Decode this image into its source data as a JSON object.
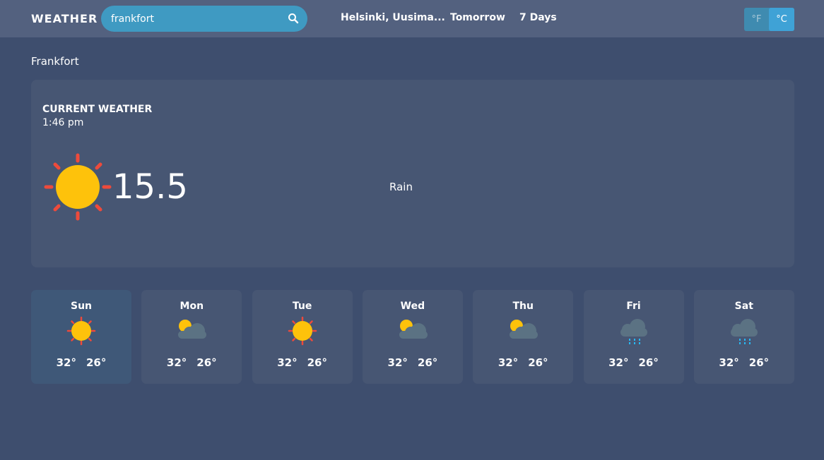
{
  "header": {
    "brand": "WEATHER",
    "search_value": "frankfort",
    "nav": [
      "Helsinki, Uusima...",
      "Tomorrow",
      "7 Days"
    ],
    "unit_f": "°F",
    "unit_c": "°C",
    "active_unit": "°C"
  },
  "city": "Frankfort",
  "current": {
    "title": "CURRENT WEATHER",
    "time": "1:46 pm",
    "icon": "sun-icon",
    "temp": "15.5",
    "description": "Rain"
  },
  "days": [
    {
      "name": "Sun",
      "icon": "sun-icon",
      "high": "32°",
      "low": "26°",
      "active": true
    },
    {
      "name": "Mon",
      "icon": "partly-cloudy-icon",
      "high": "32°",
      "low": "26°"
    },
    {
      "name": "Tue",
      "icon": "sun-icon",
      "high": "32°",
      "low": "26°"
    },
    {
      "name": "Wed",
      "icon": "partly-cloudy-icon",
      "high": "32°",
      "low": "26°"
    },
    {
      "name": "Thu",
      "icon": "partly-cloudy-icon",
      "high": "32°",
      "low": "26°"
    },
    {
      "name": "Fri",
      "icon": "rain-cloud-icon",
      "high": "32°",
      "low": "26°"
    },
    {
      "name": "Sat",
      "icon": "rain-cloud-icon",
      "high": "32°",
      "low": "26°"
    }
  ],
  "colors": {
    "background": "#3e4e6e",
    "topbar": "#53617f",
    "card": "#475673",
    "card_active": "#3f5878",
    "accent": "#3fa2d6",
    "sun": "#fec20b",
    "sun_rays": "#ee4a3b",
    "cloud": "#5b7283",
    "rain": "#29b6f0"
  }
}
